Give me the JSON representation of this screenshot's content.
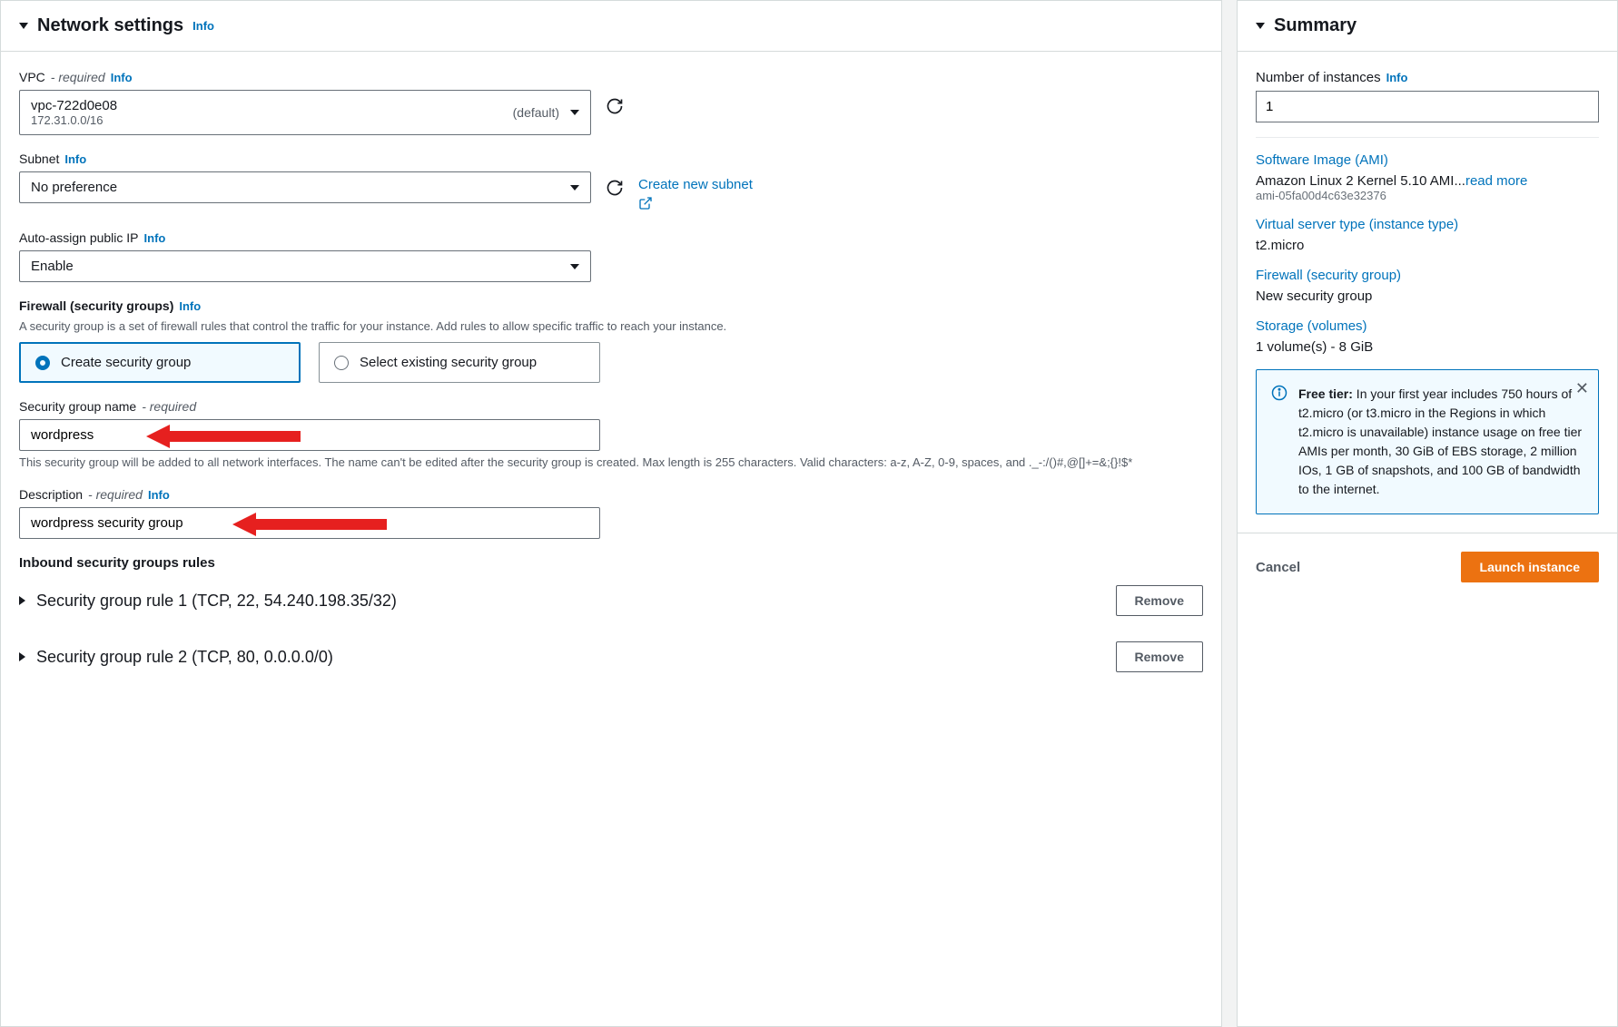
{
  "main": {
    "section_title": "Network settings",
    "info": "Info",
    "vpc": {
      "label": "VPC",
      "required": "- required",
      "value_main": "vpc-722d0e08",
      "value_sub": "172.31.0.0/16",
      "default_text": "(default)"
    },
    "subnet": {
      "label": "Subnet",
      "value": "No preference",
      "create_link": "Create new subnet"
    },
    "public_ip": {
      "label": "Auto-assign public IP",
      "value": "Enable"
    },
    "firewall": {
      "label": "Firewall (security groups)",
      "helper": "A security group is a set of firewall rules that control the traffic for your instance. Add rules to allow specific traffic to reach your instance.",
      "option_create": "Create security group",
      "option_select": "Select existing security group"
    },
    "sg_name": {
      "label": "Security group name",
      "required": "- required",
      "value": "wordpress",
      "helper": "This security group will be added to all network interfaces. The name can't be edited after the security group is created. Max length is 255 characters. Valid characters: a-z, A-Z, 0-9, spaces, and ._-:/()#,@[]+=&;{}!$*"
    },
    "sg_desc": {
      "label": "Description",
      "required": "- required",
      "value": "wordpress security group"
    },
    "inbound": {
      "header": "Inbound security groups rules",
      "rules": [
        {
          "title": "Security group rule 1 (TCP, 22, 54.240.198.35/32)",
          "remove": "Remove"
        },
        {
          "title": "Security group rule 2 (TCP, 80, 0.0.0.0/0)",
          "remove": "Remove"
        }
      ]
    }
  },
  "summary": {
    "title": "Summary",
    "instances_label": "Number of instances",
    "instances_value": "1",
    "ami": {
      "heading": "Software Image (AMI)",
      "text": "Amazon Linux 2 Kernel 5.10 AMI...",
      "readmore": "read more",
      "id": "ami-05fa00d4c63e32376"
    },
    "instance_type": {
      "heading": "Virtual server type (instance type)",
      "value": "t2.micro"
    },
    "firewall": {
      "heading": "Firewall (security group)",
      "value": "New security group"
    },
    "storage": {
      "heading": "Storage (volumes)",
      "value": "1 volume(s) - 8 GiB"
    },
    "free_tier": {
      "bold": "Free tier:",
      "text": " In your first year includes 750 hours of t2.micro (or t3.micro in the Regions in which t2.micro is unavailable) instance usage on free tier AMIs per month, 30 GiB of EBS storage, 2 million IOs, 1 GB of snapshots, and 100 GB of bandwidth to the internet."
    },
    "cancel": "Cancel",
    "launch": "Launch instance"
  }
}
